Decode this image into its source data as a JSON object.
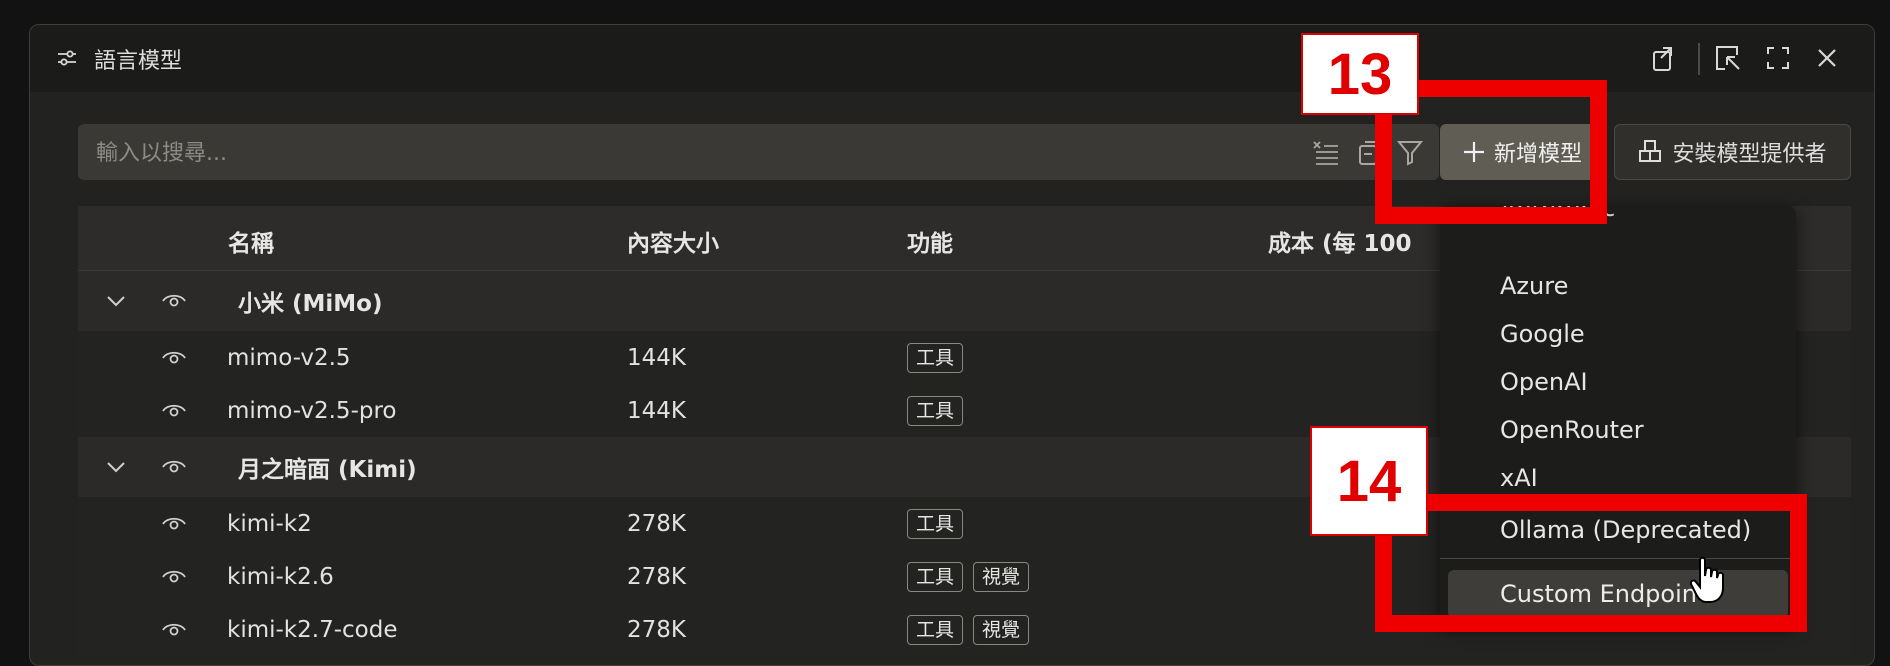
{
  "window": {
    "title": "語言模型"
  },
  "search": {
    "placeholder": "輸入以搜尋..."
  },
  "toolbar": {
    "add_model_label": "新增模型",
    "install_provider_label": "安裝模型提供者"
  },
  "table": {
    "columns": [
      "名稱",
      "內容大小",
      "功能",
      "成本 (每 100"
    ],
    "groups": [
      {
        "name": "小米 (MiMo)",
        "models": [
          {
            "name": "mimo-v2.5",
            "context": "144K",
            "tags": [
              "工具"
            ]
          },
          {
            "name": "mimo-v2.5-pro",
            "context": "144K",
            "tags": [
              "工具"
            ]
          }
        ]
      },
      {
        "name": "月之暗面 (Kimi)",
        "models": [
          {
            "name": "kimi-k2",
            "context": "278K",
            "tags": [
              "工具"
            ]
          },
          {
            "name": "kimi-k2.6",
            "context": "278K",
            "tags": [
              "工具",
              "視覺"
            ]
          },
          {
            "name": "kimi-k2.7-code",
            "context": "278K",
            "tags": [
              "工具",
              "視覺"
            ]
          }
        ]
      }
    ]
  },
  "dropdown": {
    "items": [
      "Azure",
      "Google",
      "OpenAI",
      "OpenRouter",
      "xAI"
    ],
    "custom_label": "Custom Endpoint"
  },
  "callouts": [
    "13",
    "14"
  ],
  "colors": {
    "callout": "#ee0000",
    "accent_button": "#5f5d54"
  }
}
